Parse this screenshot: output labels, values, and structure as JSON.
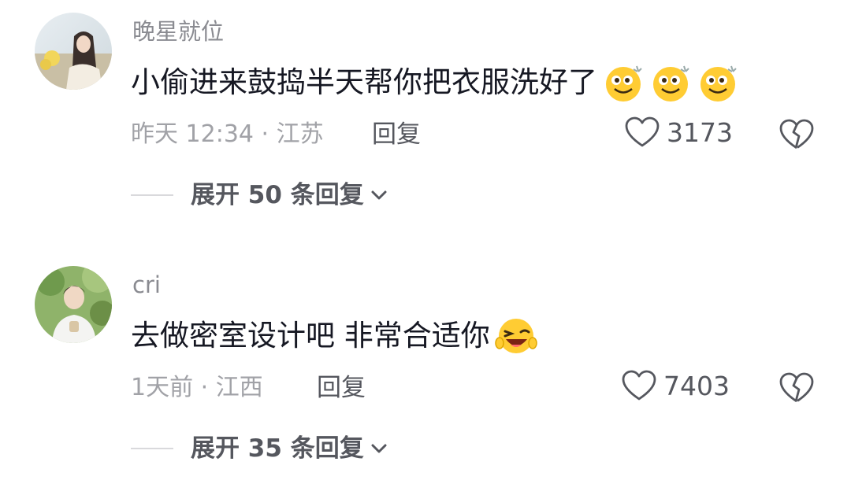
{
  "comments": [
    {
      "username": "晚星就位",
      "text": "小偷进来鼓捣半天帮你把衣服洗好了",
      "emoji_icons": [
        "grin-sweat-icon",
        "grin-sweat-icon",
        "grin-sweat-icon"
      ],
      "meta": "昨天 12:34 · 江苏",
      "reply_label": "回复",
      "like_count": "3173",
      "expand_label": "展开 50 条回复"
    },
    {
      "username": "cri",
      "text": "去做密室设计吧 非常合适你",
      "emoji_icons": [
        "laughing-wink-icon"
      ],
      "meta": "1天前 · 江西",
      "reply_label": "回复",
      "like_count": "7403",
      "expand_label": "展开 35 条回复"
    }
  ],
  "colors": {
    "username": "#8a8b91",
    "text": "#161823",
    "meta": "#a1a2a7",
    "action": "#55575e",
    "emoji_face": "#ffcc33"
  }
}
